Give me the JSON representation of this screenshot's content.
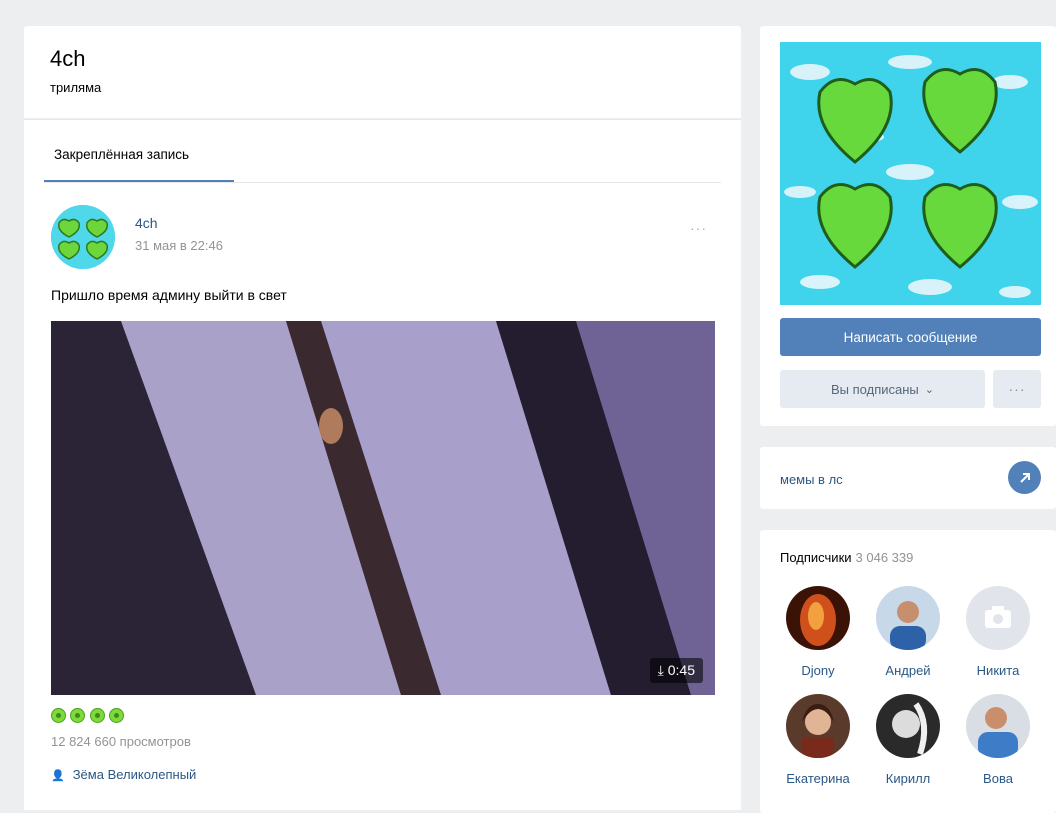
{
  "group": {
    "name": "4ch",
    "status": "трилямa"
  },
  "wall": {
    "tab_pinned": "Закреплённая запись"
  },
  "post": {
    "author": "4ch",
    "date": "31 мая в 22:46",
    "more": "···",
    "text": "Пришло время админу выйти в свет",
    "video_duration": "0:45",
    "views": "12 824 660 просмотров",
    "signer": "Зёма Великолепный"
  },
  "sidebar": {
    "write_button": "Написать сообщение",
    "subscribed_button": "Вы подписаны",
    "subscribed_chevron": "⌄",
    "more_button": "···",
    "link_title": "мемы в лс",
    "subscribers_label": "Подписчики",
    "subscribers_count": "3 046 339",
    "members": [
      {
        "name": "Djony"
      },
      {
        "name": "Андрей"
      },
      {
        "name": "Никита"
      },
      {
        "name": "Екатерина"
      },
      {
        "name": "Кирилл"
      },
      {
        "name": "Вова"
      }
    ]
  },
  "colors": {
    "accent": "#5181b8",
    "link": "#2a5885",
    "muted": "#939393",
    "background": "#edeef0"
  },
  "icons": [
    "download-icon",
    "emoji-icon",
    "user-icon",
    "arrow-up-right-icon",
    "camera-icon"
  ]
}
